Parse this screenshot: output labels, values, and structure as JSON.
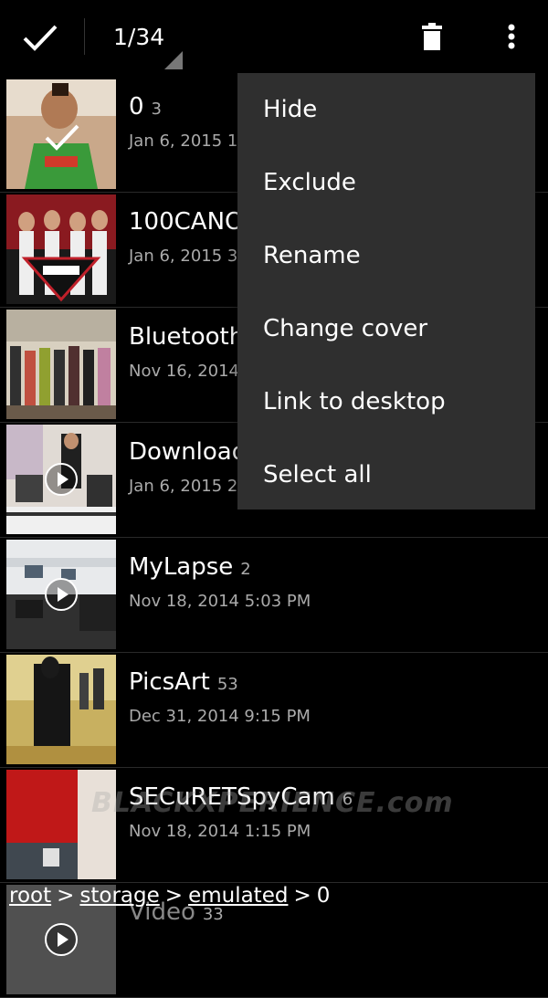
{
  "actionbar": {
    "counter": "1/34"
  },
  "icons": {
    "done": "check-icon",
    "delete": "trash-icon",
    "overflow": "more-vert-icon"
  },
  "folders": [
    {
      "name": "0",
      "count": "3",
      "date": "Jan 6, 2015 1"
    },
    {
      "name": "100CANO",
      "count": "",
      "date": "Jan 6, 2015 3"
    },
    {
      "name": "Bluetooth",
      "count": "",
      "date": "Nov 16, 2014"
    },
    {
      "name": "Download",
      "count": "",
      "date": "Jan 6, 2015 2"
    },
    {
      "name": "MyLapse",
      "count": "2",
      "date": "Nov 18, 2014 5:03 PM"
    },
    {
      "name": "PicsArt",
      "count": "53",
      "date": "Dec 31, 2014 9:15 PM"
    },
    {
      "name": "SECuRETSpyCam",
      "count": "6",
      "date": "Nov 18, 2014 1:15 PM"
    },
    {
      "name": "Video",
      "count": "33",
      "date": ""
    }
  ],
  "menu": {
    "items": [
      "Hide",
      "Exclude",
      "Rename",
      "Change cover",
      "Link to desktop",
      "Select all"
    ]
  },
  "breadcrumb": {
    "parts": [
      "root",
      "storage",
      "emulated",
      "0"
    ],
    "separator": ">"
  },
  "watermark": "BLACKXPERIENCE.com",
  "colors": {
    "background": "#000000",
    "menu_bg": "#2f2f2f",
    "secondary_text": "#aaaaaa"
  }
}
